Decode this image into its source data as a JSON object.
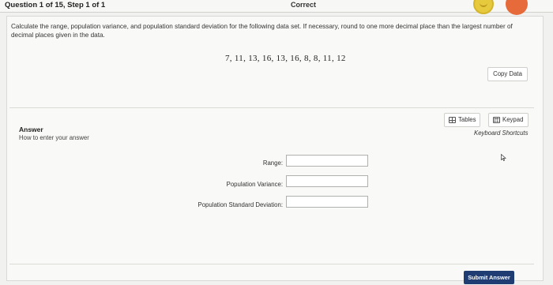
{
  "header": {
    "question_label": "Question 1 of 15, Step 1 of 1",
    "status": "Correct"
  },
  "question": {
    "instructions": "Calculate the range, population variance, and population standard deviation for the following data set. If necessary, round to one more decimal place than the largest number of decimal places given in the data.",
    "dataset": "7, 11, 13, 16, 13, 16, 8, 8, 11, 12",
    "copy_data_label": "Copy Data"
  },
  "answer": {
    "label": "Answer",
    "how_to": "How to enter your answer",
    "tables_label": "Tables",
    "keypad_label": "Keypad",
    "shortcuts_label": "Keyboard Shortcuts",
    "fields": [
      {
        "label": "Range:",
        "value": ""
      },
      {
        "label": "Population Variance:",
        "value": ""
      },
      {
        "label": "Population Standard Deviation:",
        "value": ""
      }
    ],
    "submit_label": "Submit Answer"
  },
  "colors": {
    "submit_bg": "#1f3d73",
    "status_circle_yellow": "#e7c93d",
    "status_circle_orange": "#e66a3a"
  },
  "icons": [
    "smiley-icon",
    "profile-icon",
    "table-icon",
    "keypad-icon",
    "mouse-cursor-icon"
  ]
}
